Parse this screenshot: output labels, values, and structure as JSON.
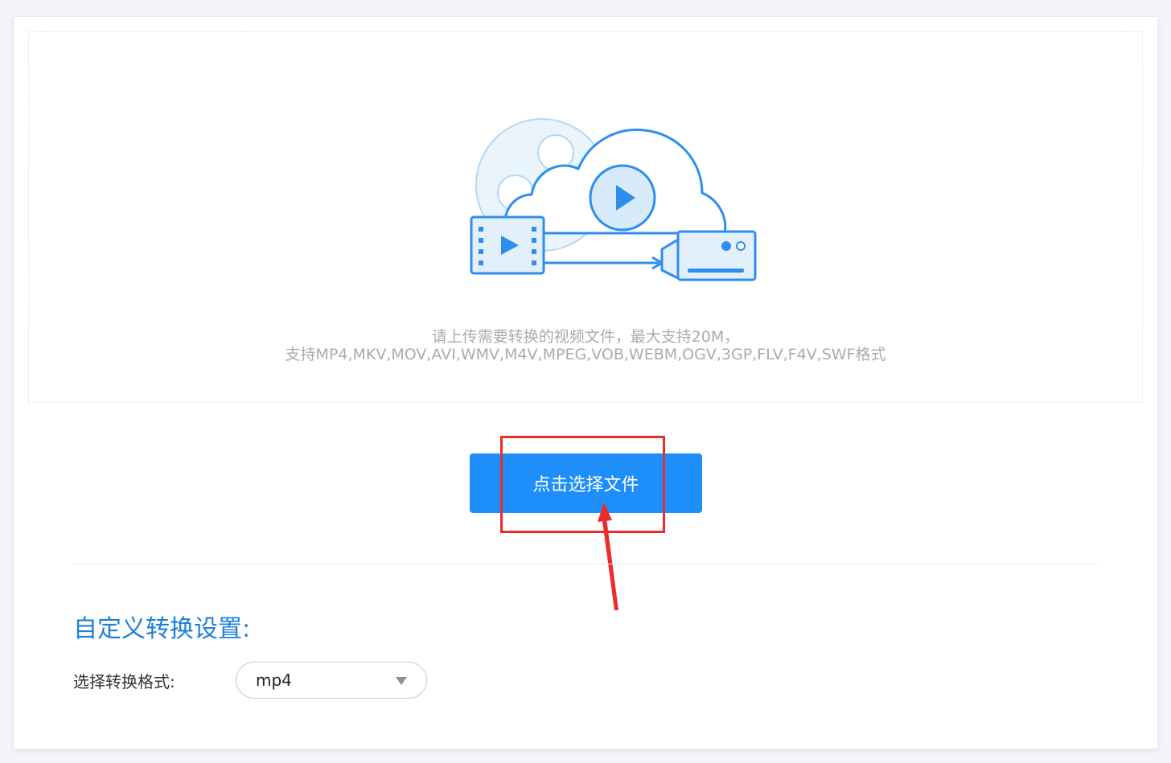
{
  "upload": {
    "hint_line1": "请上传需要转换的视频文件，最大支持20M，",
    "hint_line2": "支持MP4,MKV,MOV,AVI,WMV,M4V,MPEG,VOB,WEBM,OGV,3GP,FLV,F4V,SWF格式",
    "button_label": "点击选择文件"
  },
  "settings": {
    "title": "自定义转换设置:",
    "format_label": "选择转换格式:",
    "format_value": "mp4"
  },
  "colors": {
    "accent": "#1e8efb",
    "title": "#1e7fd9",
    "annotation": "#ee2a2a"
  },
  "icons": {
    "illustration": "cloud-video-upload-illustration",
    "dropdown": "caret-down-icon"
  }
}
